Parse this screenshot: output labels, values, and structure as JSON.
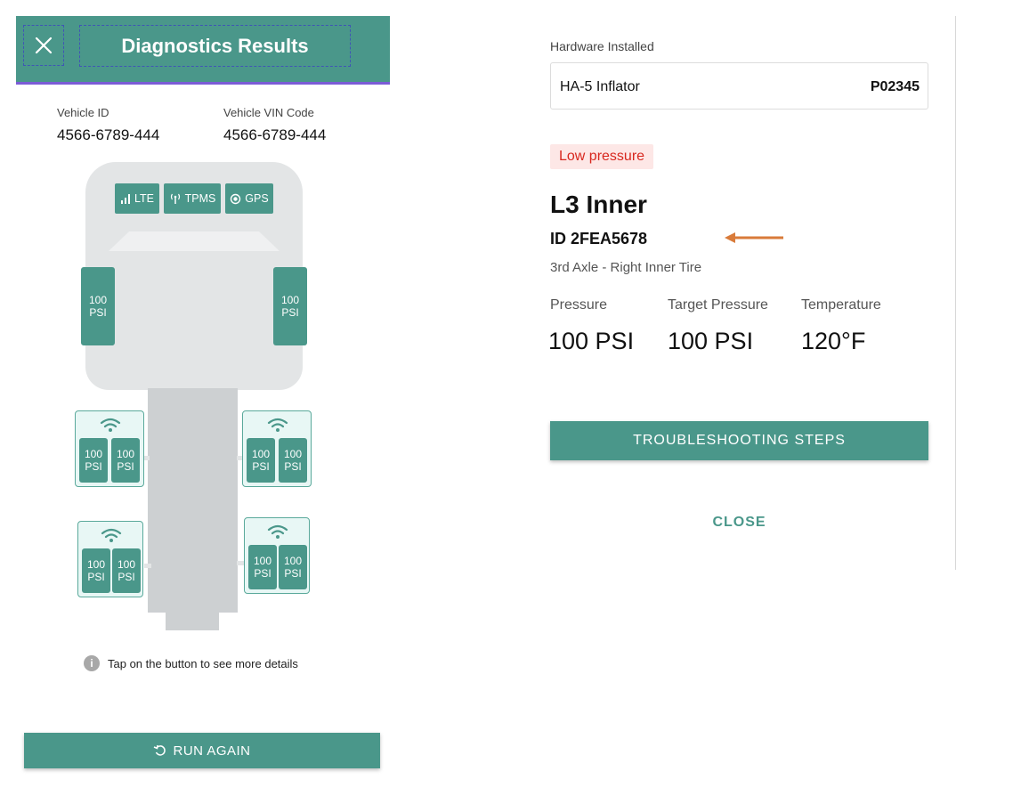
{
  "left": {
    "header": {
      "title": "Diagnostics Results",
      "close_icon": "close-icon"
    },
    "vehicle_id": {
      "label": "Vehicle ID",
      "value": "4566-6789-444"
    },
    "vin": {
      "label": "Vehicle VIN Code",
      "value": "4566-6789-444"
    },
    "chips": [
      {
        "label": "LTE",
        "icon": "signal-bars-icon"
      },
      {
        "label": "TPMS",
        "icon": "antenna-icon"
      },
      {
        "label": "GPS",
        "icon": "target-icon"
      }
    ],
    "tires": {
      "front_left": {
        "value": "100",
        "unit": "PSI"
      },
      "front_right": {
        "value": "100",
        "unit": "PSI"
      },
      "axle2_left_outer": {
        "value": "100",
        "unit": "PSI"
      },
      "axle2_left_inner": {
        "value": "100",
        "unit": "PSI"
      },
      "axle2_right_inner": {
        "value": "100",
        "unit": "PSI"
      },
      "axle2_right_outer": {
        "value": "100",
        "unit": "PSI"
      },
      "axle3_left_outer": {
        "value": "100",
        "unit": "PSI"
      },
      "axle3_left_inner": {
        "value": "100",
        "unit": "PSI"
      },
      "axle3_right_inner": {
        "value": "100",
        "unit": "PSI"
      },
      "axle3_right_outer": {
        "value": "100",
        "unit": "PSI"
      }
    },
    "hint": "Tap on the button to see more details",
    "hint_icon": "info-icon",
    "run_again": {
      "label": "RUN AGAIN",
      "icon": "refresh-icon"
    }
  },
  "right": {
    "hardware": {
      "label": "Hardware Installed",
      "name": "HA-5 Inflator",
      "code": "P02345"
    },
    "badge": "Low pressure",
    "tire_title": "L3 Inner",
    "tire_id": "ID 2FEA5678",
    "tire_desc": "3rd Axle - Right Inner Tire",
    "stats": [
      {
        "label": "Pressure",
        "value": "100 PSI"
      },
      {
        "label": "Target Pressure",
        "value": "100 PSI"
      },
      {
        "label": "Temperature",
        "value": "120°F"
      }
    ],
    "troubleshooting": "TROUBLESHOOTING STEPS",
    "close": "CLOSE",
    "annotation_arrow_color": "#d97b3a"
  },
  "colors": {
    "accent": "#4a978a",
    "header_border": "#7b5cd6",
    "badge_text": "#d8281f",
    "badge_bg": "#fde7e6"
  }
}
